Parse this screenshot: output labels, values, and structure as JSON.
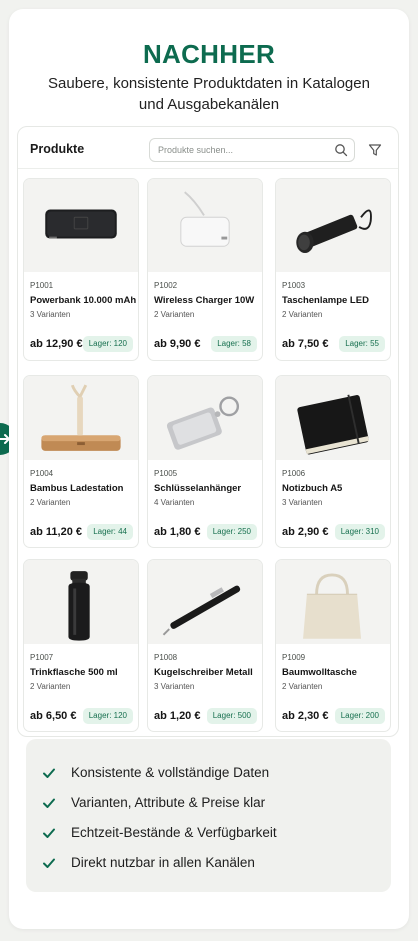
{
  "header": {
    "title": "NACHHER",
    "subtitle": "Saubere, konsistente Produktdaten in Katalogen und Ausgabekanälen"
  },
  "panel": {
    "title": "Produkte",
    "search_placeholder": "Produkte suchen...",
    "search_icon": "search-icon",
    "filter_icon": "filter-icon"
  },
  "products": [
    {
      "sku": "P1001",
      "name": "Powerbank 10.000 mAh",
      "variants": "3 Varianten",
      "price": "ab 12,90 €",
      "stock": "Lager: 120",
      "image": "powerbank"
    },
    {
      "sku": "P1002",
      "name": "Wireless Charger 10W",
      "variants": "2 Varianten",
      "price": "ab 9,90 €",
      "stock": "Lager: 58",
      "image": "wireless-charger"
    },
    {
      "sku": "P1003",
      "name": "Taschenlampe LED",
      "variants": "2 Varianten",
      "price": "ab 7,50 €",
      "stock": "Lager: 55",
      "image": "flashlight"
    },
    {
      "sku": "P1004",
      "name": "Bambus Ladestation",
      "variants": "2 Varianten",
      "price": "ab 11,20 €",
      "stock": "Lager: 44",
      "image": "bamboo-station"
    },
    {
      "sku": "P1005",
      "name": "Schlüsselanhänger",
      "variants": "4 Varianten",
      "price": "ab 1,80 €",
      "stock": "Lager: 250",
      "image": "keychain"
    },
    {
      "sku": "P1006",
      "name": "Notizbuch A5",
      "variants": "3 Varianten",
      "price": "ab 2,90 €",
      "stock": "Lager: 310",
      "image": "notebook"
    },
    {
      "sku": "P1007",
      "name": "Trinkflasche 500 ml",
      "variants": "2 Varianten",
      "price": "ab 6,50 €",
      "stock": "Lager: 120",
      "image": "bottle"
    },
    {
      "sku": "P1008",
      "name": "Kugelschreiber Metall",
      "variants": "3 Varianten",
      "price": "ab 1,20 €",
      "stock": "Lager: 500",
      "image": "pen"
    },
    {
      "sku": "P1009",
      "name": "Baumwolltasche",
      "variants": "2 Varianten",
      "price": "ab 2,30 €",
      "stock": "Lager: 200",
      "image": "tote-bag"
    }
  ],
  "benefits": [
    "Konsistente & vollständige Daten",
    "Varianten, Attribute & Preise klar",
    "Echtzeit-Bestände & Verfügbarkeit",
    "Direkt nutzbar in allen Kanälen"
  ],
  "colors": {
    "brand": "#0d6b4f",
    "badge_bg": "#e3f3ea",
    "badge_text": "#17704f"
  }
}
